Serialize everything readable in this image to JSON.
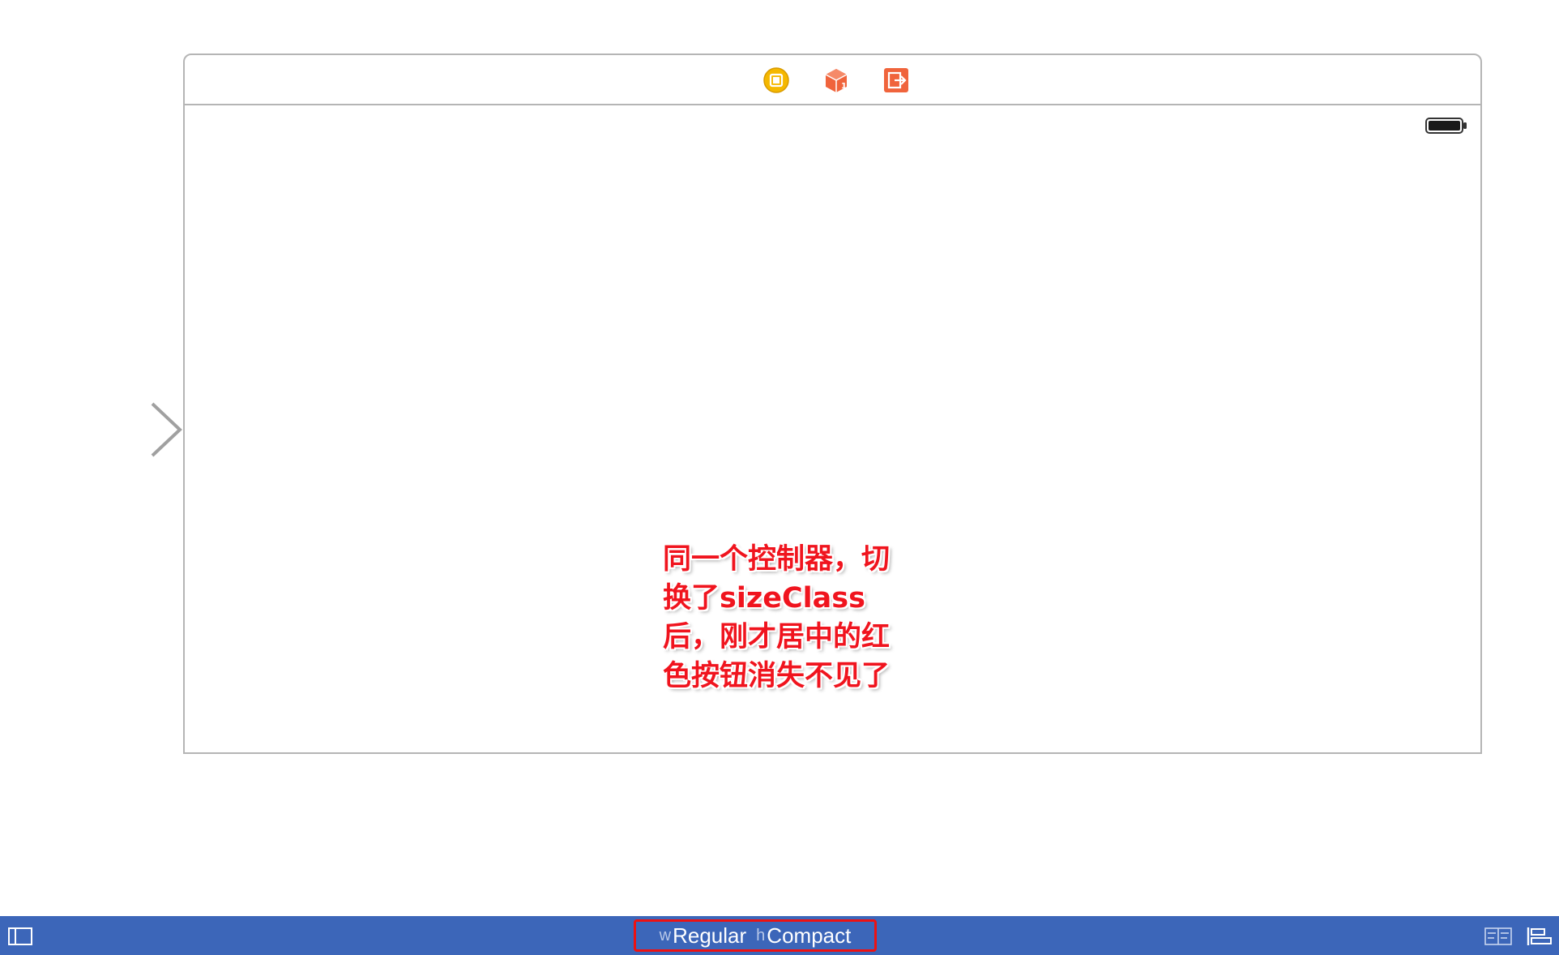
{
  "scene": {
    "dock_icons": [
      "view-controller-icon",
      "first-responder-icon",
      "exit-icon"
    ],
    "status_bar": {
      "battery_icon": "battery-icon"
    }
  },
  "annotation": {
    "lines": [
      "同一个控制器，切",
      "换了sizeClass",
      "后，刚才居中的红",
      "色按钮消失不见了"
    ],
    "color": "#f0141e"
  },
  "bottom_bar": {
    "background": "#3c66b9",
    "size_class": {
      "width_prefix": "w",
      "width_value": "Regular",
      "height_prefix": "h",
      "height_value": "Compact",
      "highlight_color": "#ee1111"
    },
    "icons": [
      "navigator-toggle-icon",
      "embed-in-stack-icon",
      "align-icon"
    ]
  },
  "colors": {
    "dock_orange": "#f0643c",
    "dock_yellow": "#f5b800"
  }
}
